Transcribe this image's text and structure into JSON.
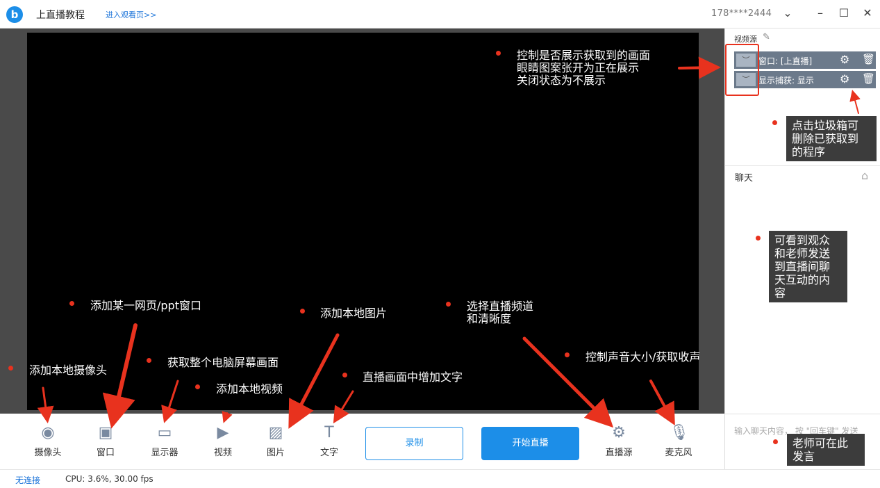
{
  "titlebar": {
    "logo": "b",
    "title": "上直播教程",
    "watch_link": "进入观看页>>",
    "account": "178****2444"
  },
  "sidebar": {
    "sources_title": "视频源",
    "sources": [
      {
        "label": "窗口: [上直播]"
      },
      {
        "label": "显示捕获: 显示"
      }
    ],
    "chat_title": "聊天",
    "chat_input_placeholder": "输入聊天内容， 按 \"回车键\" 发送"
  },
  "toolbar": {
    "tools": [
      {
        "label": "摄像头",
        "icon": "camera-icon"
      },
      {
        "label": "窗口",
        "icon": "window-icon"
      },
      {
        "label": "显示器",
        "icon": "monitor-icon"
      },
      {
        "label": "视频",
        "icon": "video-icon"
      },
      {
        "label": "图片",
        "icon": "image-icon"
      },
      {
        "label": "文字",
        "icon": "text-icon"
      }
    ],
    "record_label": "录制",
    "live_label": "开始直播",
    "stream_source_label": "直播源",
    "mic_label": "麦克风"
  },
  "status": {
    "network": "无连接",
    "cpu": "CPU: 3.6%,  30.00 fps"
  },
  "annotations": {
    "eye": [
      "控制是否展示获取到的画面",
      "眼睛图案张开为正在展示",
      "关闭状态为不展示"
    ],
    "trash": [
      "点击垃圾箱可",
      "删除已获取到",
      "的程序"
    ],
    "chat": [
      "可看到观众",
      "和老师发送",
      "到直播间聊",
      "天互动的内",
      "容"
    ],
    "webpage": "添加某一网页/ppt窗口",
    "image": "添加本地图片",
    "channel": [
      "选择直播频道",
      "和清晰度"
    ],
    "camera": "添加本地摄像头",
    "screen": "获取整个电脑屏幕画面",
    "video": "添加本地视频",
    "text": "直播画面中增加文字",
    "sound": "控制声音大小/获取收声",
    "speak": [
      "老师可在此",
      "发言"
    ]
  },
  "colors": {
    "accent": "#1c8ee8",
    "annotation_red": "#e8321e"
  }
}
